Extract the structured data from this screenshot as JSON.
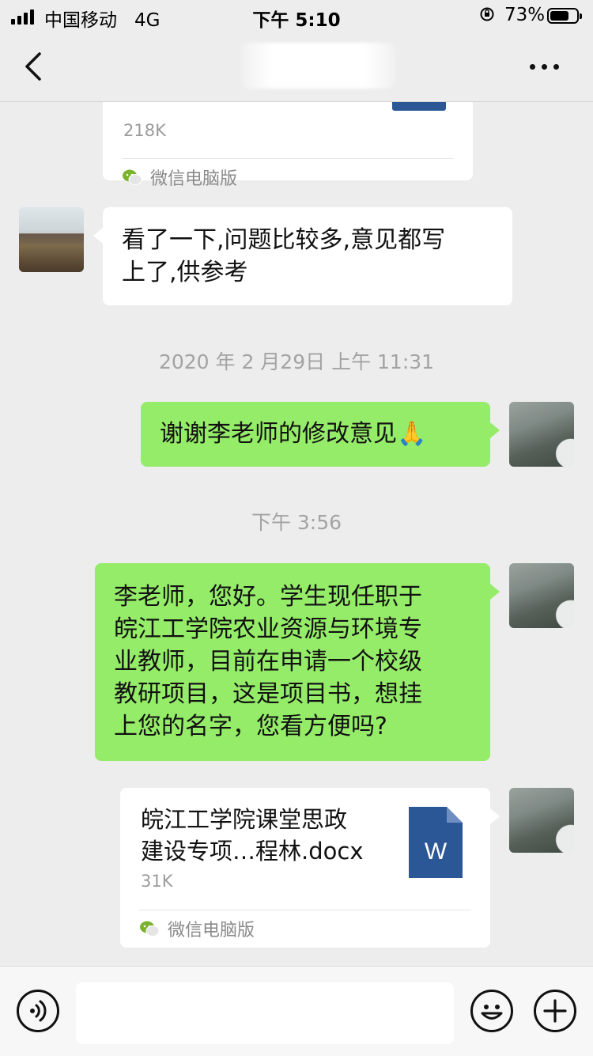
{
  "status_bar": {
    "carrier": "中国移动",
    "network": "4G",
    "time": "下午 5:10",
    "battery_percent": "73%",
    "battery_level": 0.73
  },
  "nav": {
    "back_icon": "chevron-left-icon",
    "more_icon": "ellipsis-icon"
  },
  "messages": {
    "file1": {
      "size": "218K",
      "source": "微信电脑版"
    },
    "msg1": {
      "text_line1": "看了一下,问题比较多,意见都写",
      "text_line2": "上了,供参考"
    },
    "timestamp1": "2020 年 2 月29日 上午 11:31",
    "msg2": {
      "text": "谢谢李老师的修改意见🙏"
    },
    "timestamp2": "下午 3:56",
    "msg3": {
      "line1": "李老师，您好。学生现任职于",
      "line2": "皖江工学院农业资源与环境专",
      "line3": "业教师，目前在申请一个校级",
      "line4": "教研项目，这是项目书，想挂",
      "line5": "上您的名字，您看方便吗?"
    },
    "file2": {
      "name_line1": "皖江工学院课堂思政",
      "name_line2": "建设专项…程林.docx",
      "size": "31K",
      "source": "微信电脑版",
      "icon_letter": "W"
    }
  },
  "input_bar": {
    "placeholder": "",
    "voice_icon": "voice-icon",
    "emoji_icon": "emoji-icon",
    "plus_icon": "plus-icon"
  },
  "colors": {
    "background": "#ededed",
    "outgoing_bubble": "#95ec69",
    "incoming_bubble": "#ffffff",
    "word_blue": "#2b5797",
    "wechat_green": "#7bb32e"
  }
}
